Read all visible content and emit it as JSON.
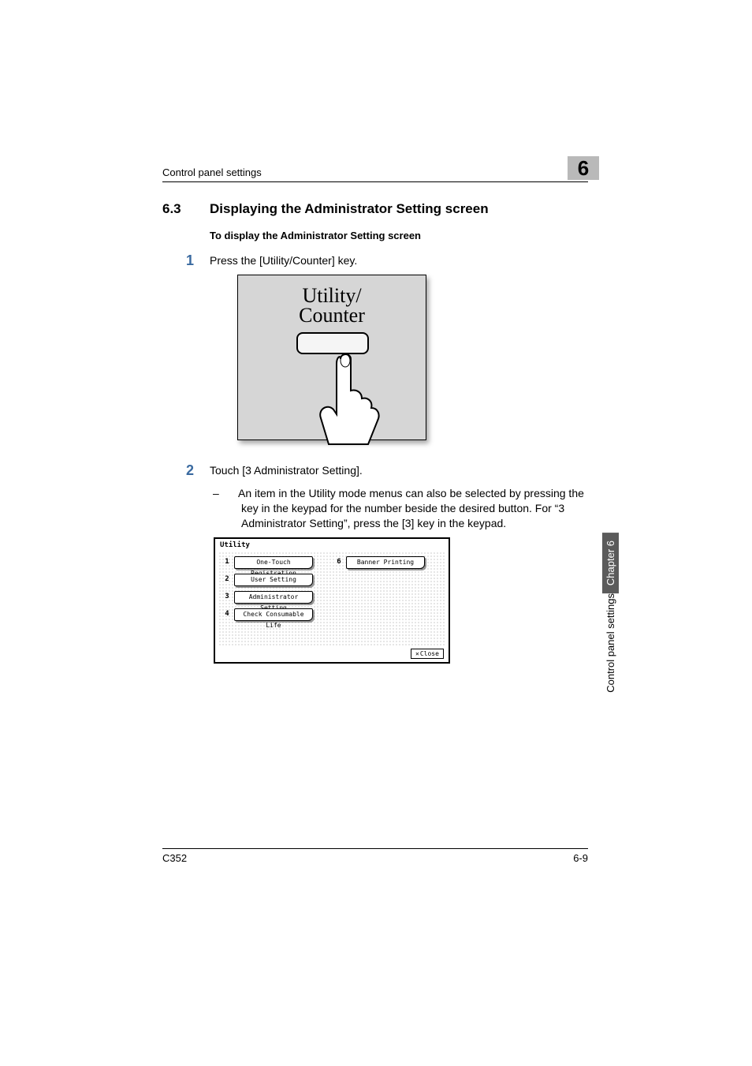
{
  "header": {
    "running_head": "Control panel settings",
    "chapter_badge": "6"
  },
  "section": {
    "number": "6.3",
    "title": "Displaying the Administrator Setting screen",
    "subheading": "To display the Administrator Setting screen"
  },
  "steps": {
    "s1": {
      "num": "1",
      "text": "Press the [Utility/Counter] key."
    },
    "s2": {
      "num": "2",
      "text": "Touch [3 Administrator Setting].",
      "note_dash": "–",
      "note": "An item in the Utility mode menus can also be selected by pressing the key in the keypad for the number beside the desired button. For “3 Administrator Setting”, press the [3] key in the keypad."
    }
  },
  "fig1": {
    "label_line1": "Utility/",
    "label_line2": "Counter"
  },
  "fig2": {
    "title": "Utility",
    "items": {
      "n1": "1",
      "b1": "One-Touch Registration",
      "n2": "2",
      "b2": "User Setting",
      "n3": "3",
      "b3": "Administrator Setting",
      "n4": "4",
      "b4": "Check Consumable Life",
      "n6": "6",
      "b6": "Banner Printing"
    },
    "close": "Close"
  },
  "side_tab": {
    "dark": "Chapter 6",
    "light": "Control panel settings"
  },
  "footer": {
    "left": "C352",
    "right": "6-9"
  }
}
